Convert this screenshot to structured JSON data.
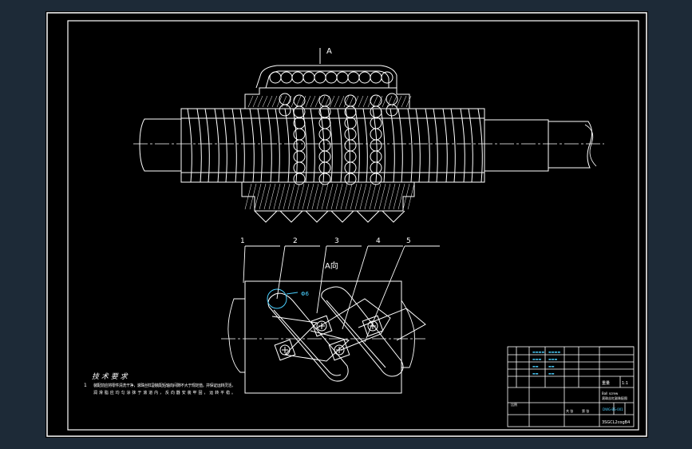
{
  "drawing": {
    "section_label": "A",
    "view_label": "A向",
    "part_numbers": [
      "1",
      "2",
      "3",
      "4",
      "5"
    ],
    "dimension_label": "Φ6",
    "tech_title": "技 术 要 求",
    "tech_item_number": "1",
    "tech_line_1": "装配前应将零件清洗干净，滚珠丝杠副装配后轴向间隙不大于规定值，并保证运转灵活，",
    "tech_line_2": "润滑脂应均匀涂抹于滚道内，反向器安装牢固，运转平稳。"
  },
  "title_block": {
    "company_line_1": "Ball screw",
    "company_line_2": "滚珠丝杠副装配图",
    "drawing_number": "DWG-BS-001",
    "file_name": "3SGCL2cogB4",
    "scale_label": "比例",
    "scale_value": "1:1",
    "weight_label": "重量",
    "sheet_label": "共 张",
    "sheet_of": "第 张"
  },
  "colors": {
    "background": "#1d2a37",
    "sheet": "#000000",
    "line": "#ffffff",
    "dim": "#4ad0ff",
    "note": "#ffff33"
  }
}
